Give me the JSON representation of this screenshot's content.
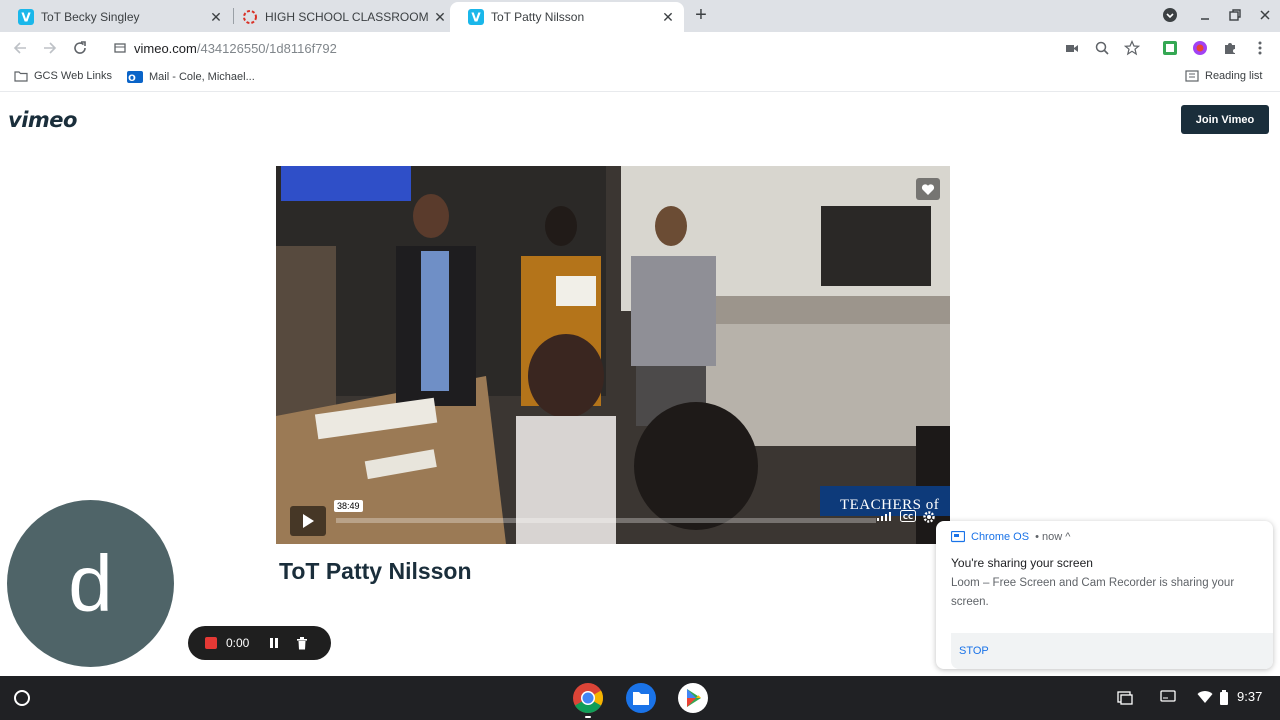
{
  "tabs": [
    {
      "title": "ToT Becky Singley",
      "icon": "vimeo-icon"
    },
    {
      "title": "HIGH SCHOOL CLASSROOM OB:",
      "icon": "loading-icon"
    },
    {
      "title": "ToT Patty Nilsson",
      "icon": "vimeo-icon",
      "active": true
    }
  ],
  "address": {
    "host": "vimeo.com",
    "path": "/434126550/1d8116f792"
  },
  "bookmarks": [
    {
      "label": "GCS Web Links",
      "icon": "folder-icon"
    },
    {
      "label": "Mail - Cole, Michael...",
      "icon": "outlook-icon"
    }
  ],
  "reading_list": "Reading list",
  "vimeo": {
    "logo": "vimeo",
    "join_label": "Join Vimeo",
    "video_title": "ToT Patty Nilsson",
    "hover_time": "38:49",
    "progress": 0.0,
    "brand_text": "TEACHERS of TOMORROW"
  },
  "loom": {
    "avatar_letter": "d",
    "elapsed": "0:00"
  },
  "notification": {
    "source": "Chrome OS",
    "time": "• now ^",
    "title": "You're sharing your screen",
    "body": "Loom – Free Screen and Cam Recorder is sharing your screen.",
    "action": "STOP"
  },
  "shelf": {
    "apps": [
      "chrome-icon",
      "files-icon",
      "play-store-icon"
    ],
    "clock": "9:37"
  },
  "colors": {
    "vimeo_dark": "#1a2e3b",
    "chrome_blue": "#1a73e8",
    "loom_red": "#e53935"
  }
}
